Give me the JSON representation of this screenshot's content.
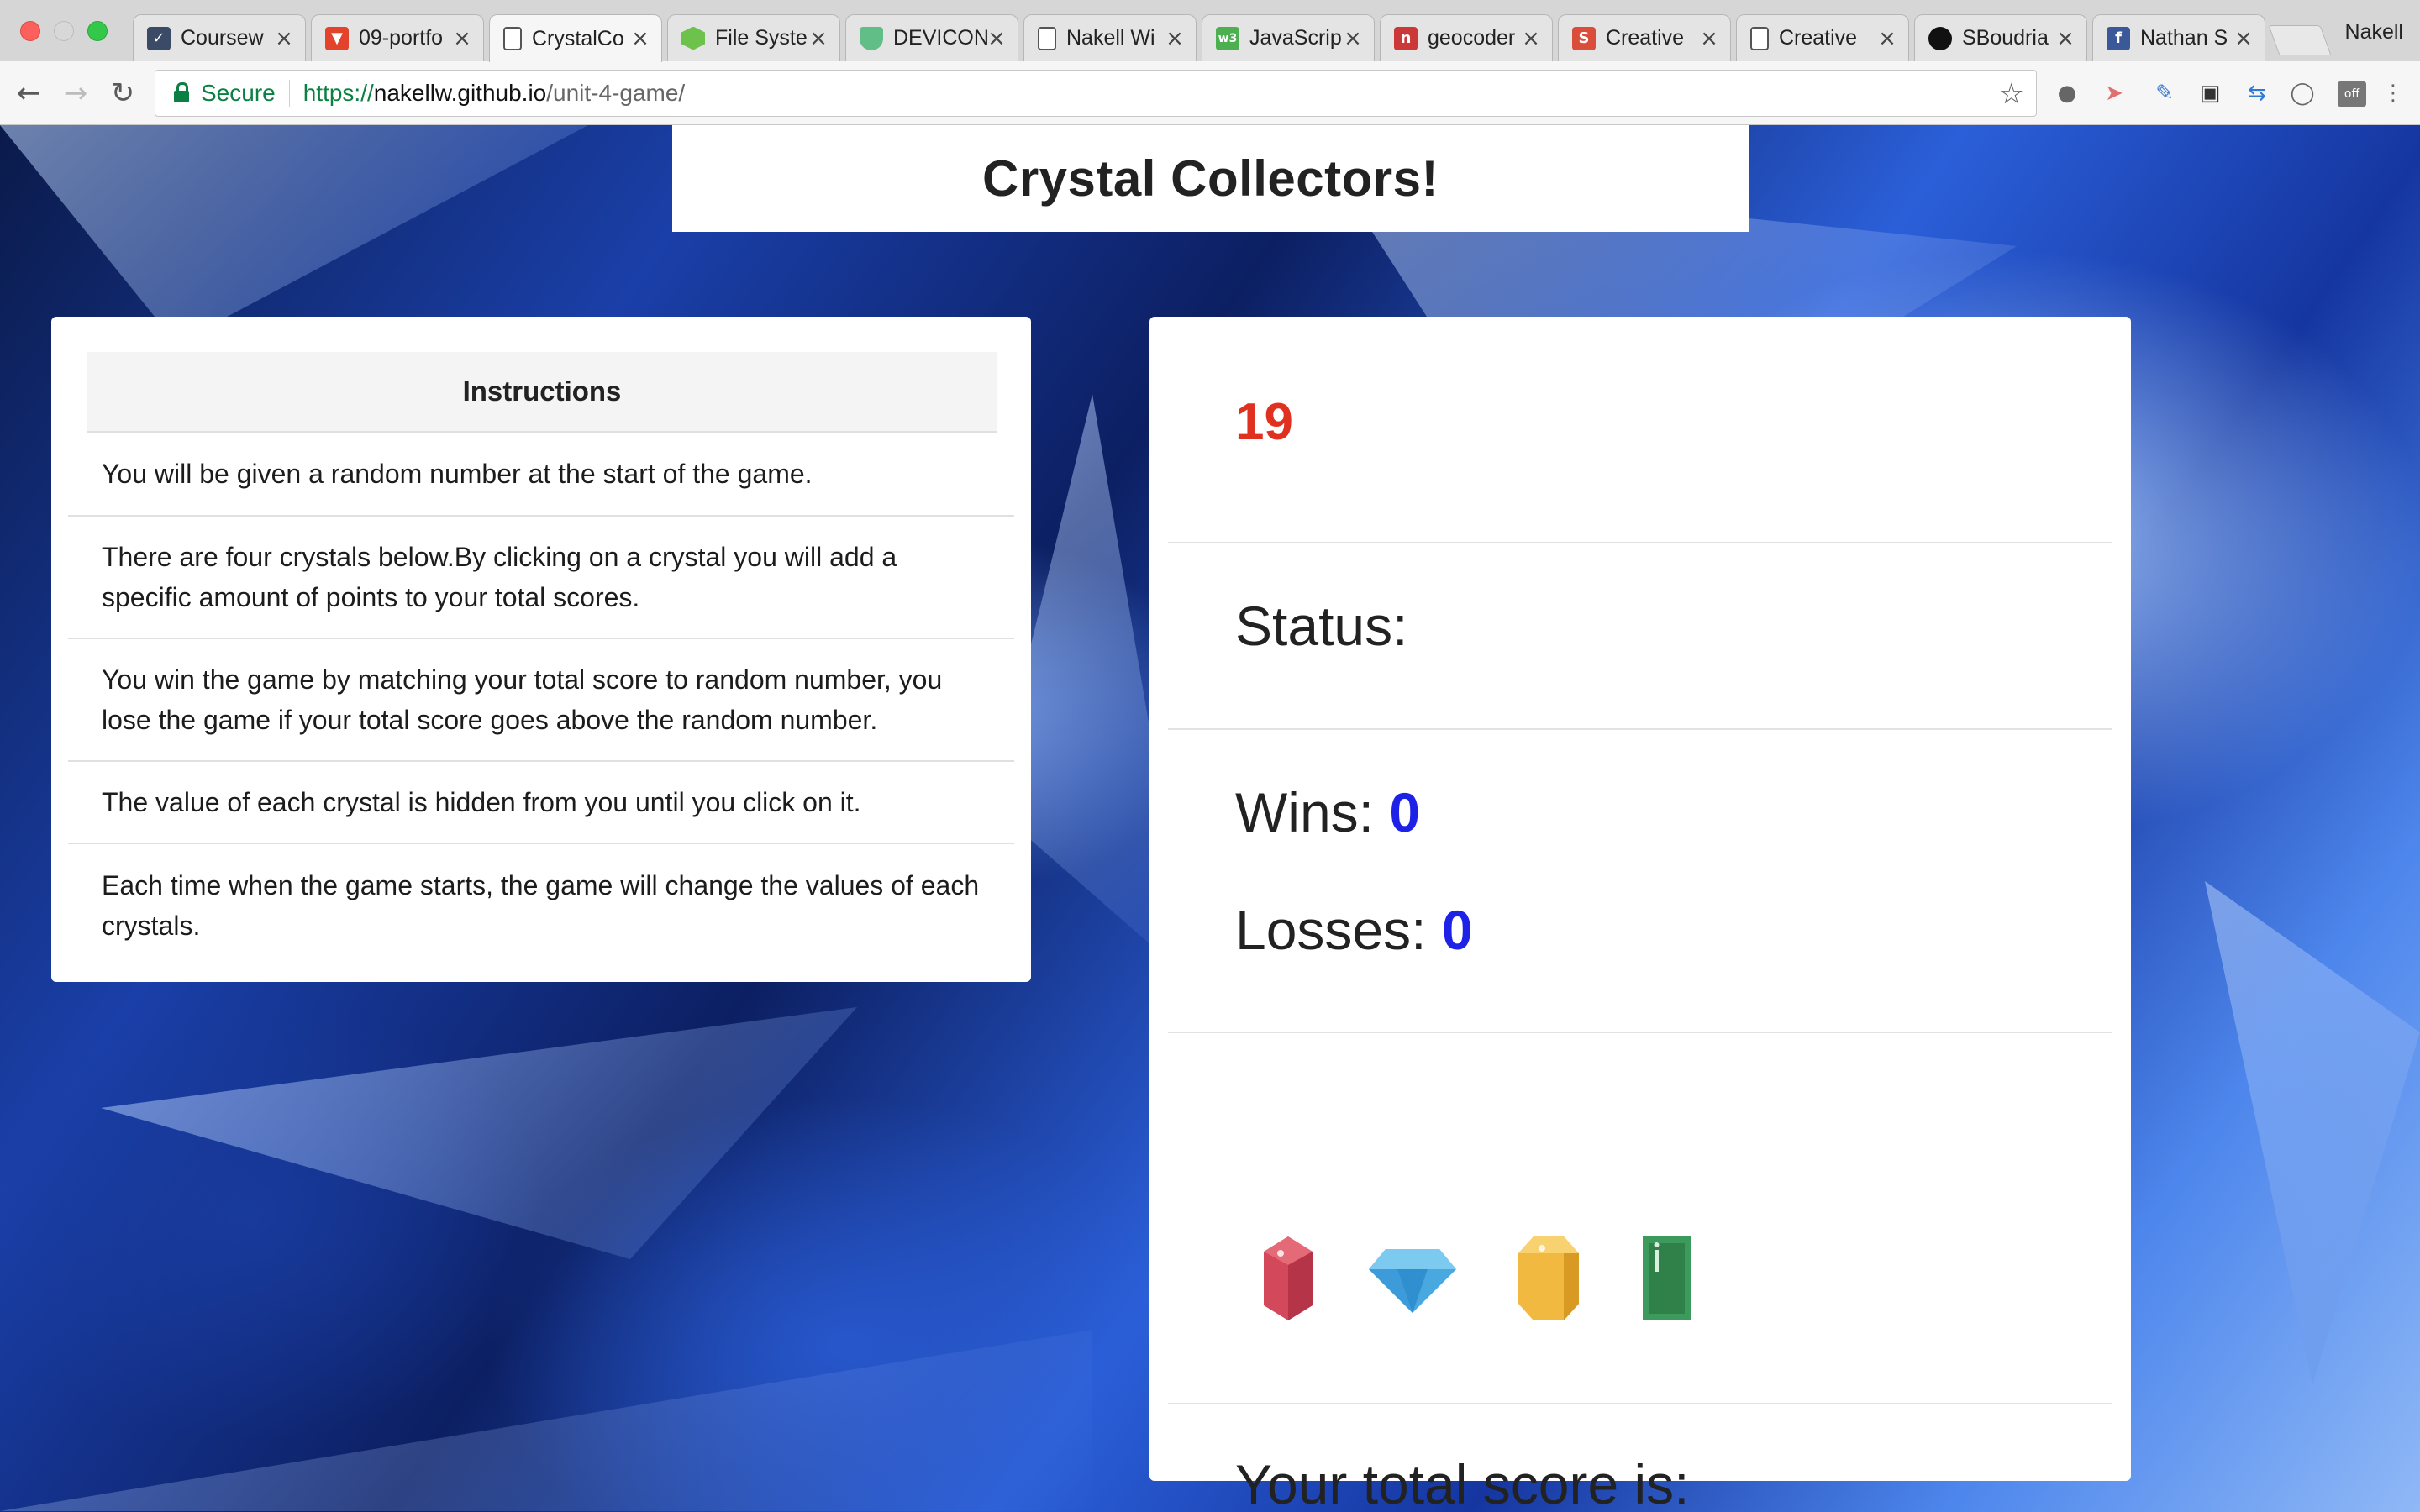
{
  "browser": {
    "tabs": [
      {
        "title": "Coursew",
        "favicon": "shield-check-icon",
        "color": "#3b4a66"
      },
      {
        "title": "09-portfo",
        "favicon": "gitlab-icon",
        "color": "#e2432a"
      },
      {
        "title": "CrystalCo",
        "favicon": "page-icon",
        "color": "#ffffff",
        "active": true
      },
      {
        "title": "File Syste",
        "favicon": "node-hexagon-icon",
        "color": "#6cc24a"
      },
      {
        "title": "DEVICON",
        "favicon": "shield-icon",
        "color": "#60be86"
      },
      {
        "title": "Nakell Wi",
        "favicon": "page-icon",
        "color": "#ffffff"
      },
      {
        "title": "JavaScrip",
        "favicon": "w3-icon",
        "color": "#4caf50"
      },
      {
        "title": "geocoder",
        "favicon": "npm-icon",
        "color": "#cb3837"
      },
      {
        "title": "Creative",
        "favicon": "s-icon",
        "color": "#d94d3a"
      },
      {
        "title": "Creative",
        "favicon": "page-icon",
        "color": "#ffffff"
      },
      {
        "title": "SBoudria",
        "favicon": "github-icon",
        "color": "#111111"
      },
      {
        "title": "Nathan S",
        "favicon": "facebook-icon",
        "color": "#3b5998"
      }
    ],
    "profile_name": "Nakell",
    "security_label": "Secure",
    "url": {
      "scheme": "https://",
      "host": "nakellw.github.io",
      "path": "/unit-4-game/"
    }
  },
  "page": {
    "title": "Crystal Collectors!",
    "instructions": {
      "heading": "Instructions",
      "items": [
        "You will be given a random number at the start of the game.",
        "There are four crystals below.By clicking on a crystal you will add a specific amount of points to your total scores.",
        "You win the game by matching your total score to random number, you lose the game if your total score goes above the random number.",
        "The value of each crystal is hidden from you until you click on it.",
        "Each time when the game starts, the game will change the values of each crystals."
      ]
    },
    "game": {
      "random_number": "19",
      "status_label": "Status:",
      "wins_label": "Wins:",
      "wins_value": "0",
      "losses_label": "Losses:",
      "losses_value": "0",
      "crystals": [
        {
          "name": "red-crystal-icon",
          "color": "#d3485a"
        },
        {
          "name": "blue-diamond-icon",
          "color": "#4aa8e0"
        },
        {
          "name": "yellow-gem-icon",
          "color": "#f2b940"
        },
        {
          "name": "green-emerald-icon",
          "color": "#3c9a5c"
        }
      ],
      "total_score_label": "Your total score is:"
    }
  }
}
